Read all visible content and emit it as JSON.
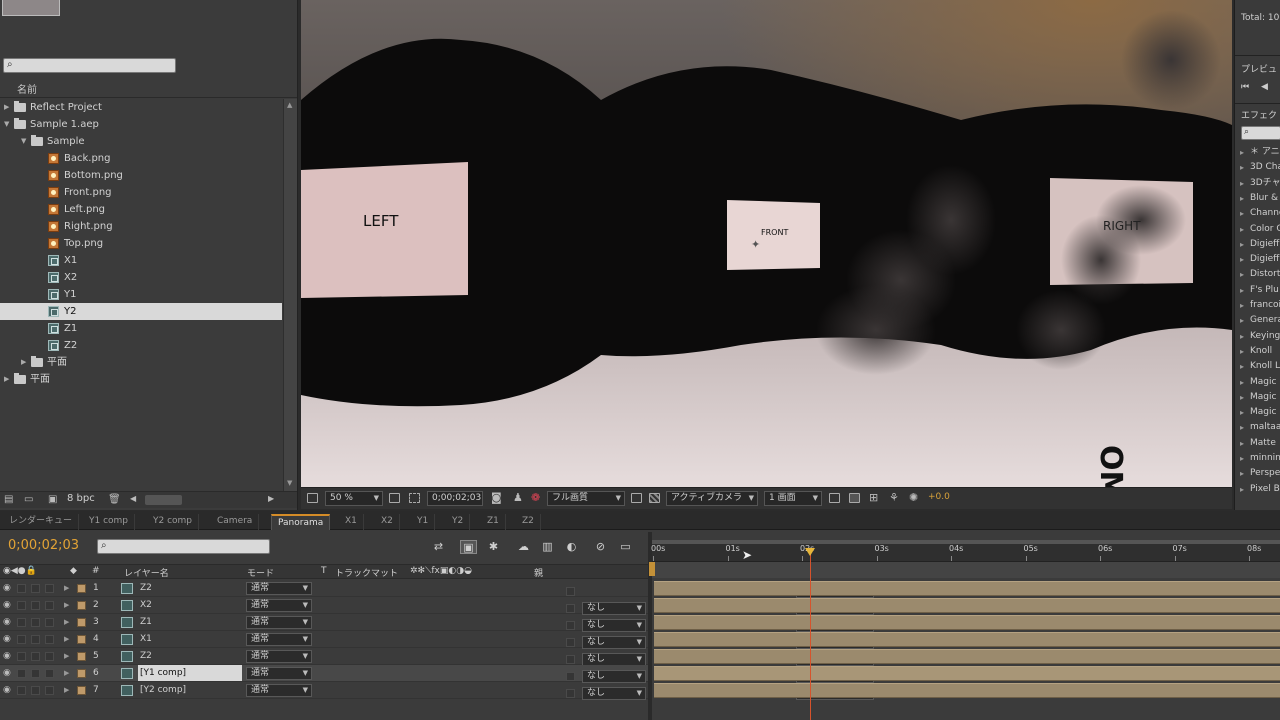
{
  "project": {
    "column_name": "名前",
    "bpc": "8 bpc",
    "items": [
      {
        "label": "Reflect Project",
        "type": "folder",
        "indent": 0,
        "twirl": "▶",
        "selected": false
      },
      {
        "label": "Sample 1.aep",
        "type": "folder",
        "indent": 0,
        "twirl": "▼",
        "selected": false
      },
      {
        "label": "Sample",
        "type": "folder",
        "indent": 1,
        "twirl": "▼",
        "selected": false
      },
      {
        "label": "Back.png",
        "type": "png",
        "indent": 2,
        "twirl": "",
        "selected": false
      },
      {
        "label": "Bottom.png",
        "type": "png",
        "indent": 2,
        "twirl": "",
        "selected": false
      },
      {
        "label": "Front.png",
        "type": "png",
        "indent": 2,
        "twirl": "",
        "selected": false
      },
      {
        "label": "Left.png",
        "type": "png",
        "indent": 2,
        "twirl": "",
        "selected": false
      },
      {
        "label": "Right.png",
        "type": "png",
        "indent": 2,
        "twirl": "",
        "selected": false
      },
      {
        "label": "Top.png",
        "type": "png",
        "indent": 2,
        "twirl": "",
        "selected": false
      },
      {
        "label": "X1",
        "type": "comp",
        "indent": 2,
        "twirl": "",
        "selected": false
      },
      {
        "label": "X2",
        "type": "comp",
        "indent": 2,
        "twirl": "",
        "selected": false
      },
      {
        "label": "Y1",
        "type": "comp",
        "indent": 2,
        "twirl": "",
        "selected": false
      },
      {
        "label": "Y2",
        "type": "comp",
        "indent": 2,
        "twirl": "",
        "selected": true
      },
      {
        "label": "Z1",
        "type": "comp",
        "indent": 2,
        "twirl": "",
        "selected": false
      },
      {
        "label": "Z2",
        "type": "comp",
        "indent": 2,
        "twirl": "",
        "selected": false
      },
      {
        "label": "平面",
        "type": "folder",
        "indent": 1,
        "twirl": "▶",
        "selected": false
      },
      {
        "label": "平面",
        "type": "folder",
        "indent": 0,
        "twirl": "▶",
        "selected": false
      }
    ]
  },
  "viewer": {
    "panel_left": "LEFT",
    "panel_front": "FRONT",
    "panel_right": "RIGHT",
    "zoom": "50 %",
    "timecode": "0;00;02;03",
    "resolution": "フル画質",
    "camera": "アクティブカメラ",
    "views": "1 画面",
    "exposure": "+0.0"
  },
  "right_panel": {
    "total": "Total: 10",
    "preview_title": "プレビュ",
    "effects_title": "エフェク",
    "effects": [
      "＊ アニ",
      "3D Cha",
      "3Dチャ",
      "Blur &",
      "Channe",
      "Color C",
      "Digieff",
      "Digieff",
      "Distort",
      "F's Plu",
      "francoi",
      "Genera",
      "Keying",
      "Knoll",
      "Knoll L",
      "Magic",
      "Magic",
      "Magic",
      "maltaa",
      "Matte",
      "minnin",
      "Perspe",
      "Pixel B"
    ]
  },
  "tabs": [
    "レンダーキュー",
    "Y1 comp",
    "Y2 comp",
    "Camera",
    "Panorama",
    "X1",
    "X2",
    "Y1",
    "Y2",
    "Z1",
    "Z2"
  ],
  "active_tab": "Panorama",
  "timeline": {
    "timecode": "0;00;02;03",
    "header": {
      "num": "#",
      "layer_name": "レイヤー名",
      "mode": "モード",
      "t": "T",
      "track_matte": "トラックマット",
      "parent": "親"
    },
    "ruler": [
      "00s",
      "01s",
      "02s",
      "03s",
      "04s",
      "05s",
      "06s",
      "07s",
      "08s"
    ],
    "layers": [
      {
        "num": "1",
        "name": "Z2",
        "mode": "通常",
        "matte": "",
        "parent": "なし",
        "selected": false
      },
      {
        "num": "2",
        "name": "X2",
        "mode": "通常",
        "matte": "なし",
        "parent": "なし",
        "selected": false
      },
      {
        "num": "3",
        "name": "Z1",
        "mode": "通常",
        "matte": "なし",
        "parent": "なし",
        "selected": false
      },
      {
        "num": "4",
        "name": "X1",
        "mode": "通常",
        "matte": "なし",
        "parent": "なし",
        "selected": false
      },
      {
        "num": "5",
        "name": "Z2",
        "mode": "通常",
        "matte": "なし",
        "parent": "なし",
        "selected": false
      },
      {
        "num": "6",
        "name": "[Y1 comp]",
        "mode": "通常",
        "matte": "なし",
        "parent": "なし",
        "selected": true
      },
      {
        "num": "7",
        "name": "[Y2 comp]",
        "mode": "通常",
        "matte": "なし",
        "parent": "なし",
        "selected": false
      }
    ]
  },
  "colors": {
    "accent": "#e3a335",
    "playhead": "#d6532c",
    "bar": "#9b8a6d",
    "label": "#bf9a6a"
  }
}
